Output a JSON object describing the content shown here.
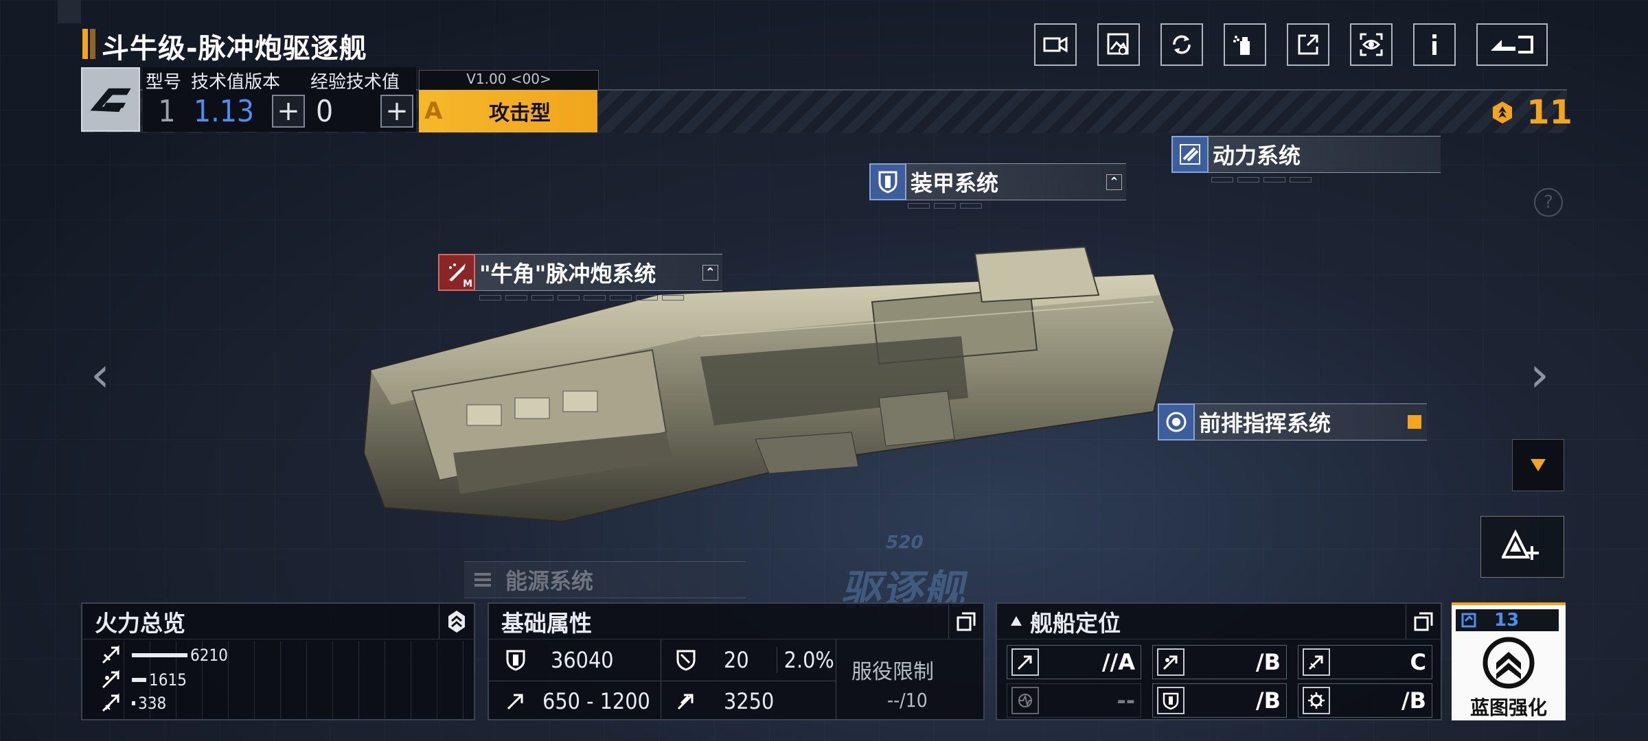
{
  "title": "斗牛级-脉冲炮驱逐舰",
  "stats": {
    "model_label": "型号",
    "tech_version_label": "技术值版本",
    "exp_tech_label": "经验技术值",
    "model_value": "1",
    "tech_version_value": "1.13",
    "exp_tech_value": "0",
    "version": "V1.00 <00>",
    "type_grade": "A",
    "type_label": "攻击型"
  },
  "rank_value": "11",
  "systems": {
    "armor": "装甲系统",
    "power": "动力系统",
    "cannon": "\"牛角\"脉冲炮系统",
    "command": "前排指挥系统",
    "energy": "能源系统"
  },
  "hud": {
    "number": "520",
    "type_text": "驱逐舰"
  },
  "firepower": {
    "title": "火力总览",
    "values": [
      "6210",
      "1615",
      "338"
    ],
    "fractions": [
      0.9,
      0.23,
      0.05
    ]
  },
  "basic": {
    "title": "基础属性",
    "hp": "36040",
    "evasion": "20",
    "evasion_pct": "2.0%",
    "speed": "650 - 1200",
    "warp": "3250",
    "service_label": "服役限制",
    "service_value": "--/10"
  },
  "roles": {
    "title": "舰船定位",
    "cells": [
      {
        "grade": "//A"
      },
      {
        "grade": "/B"
      },
      {
        "grade": "C"
      },
      {
        "grade": "--"
      },
      {
        "grade": "/B"
      },
      {
        "grade": "/B"
      }
    ]
  },
  "blueprint": {
    "count": "13",
    "label": "蓝图强化"
  },
  "colors": {
    "accent": "#f3a51b",
    "tech_blue": "#4c8ff0",
    "panel_bg": "#0a0d13"
  },
  "icons": [
    "camera-icon",
    "image-search-icon",
    "refresh-icon",
    "paint-spray-icon",
    "share-icon",
    "eye-scan-icon",
    "info-icon",
    "return-icon"
  ]
}
